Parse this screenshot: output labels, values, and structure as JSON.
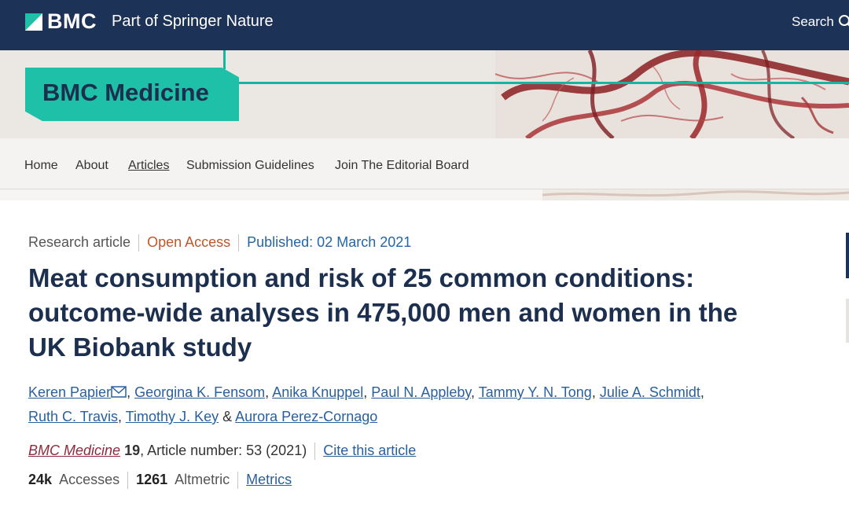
{
  "header": {
    "logo_text": "BMC",
    "logo_subtitle": "Part of Springer Nature",
    "search_label": "Search",
    "brand_color": "#1d3257"
  },
  "journal": {
    "name": "BMC Medicine",
    "accent_color": "#1fc0a8"
  },
  "nav": {
    "items": [
      "Home",
      "About",
      "Articles",
      "Submission Guidelines",
      "Join The Editorial Board"
    ],
    "active": "Articles"
  },
  "article": {
    "type": "Research article",
    "access": "Open Access",
    "published": "Published: 02 March 2021",
    "title": "Meat consumption and risk of 25 common conditions: outcome-wide analyses in 475,000 men and women in the UK Biobank study",
    "authors": [
      "Keren Papier",
      "Georgina K. Fensom",
      "Anika Knuppel",
      "Paul N. Appleby",
      "Tammy Y. N. Tong",
      "Julie A. Schmidt",
      "Ruth C. Travis",
      "Timothy J. Key",
      "Aurora Perez-Cornago"
    ],
    "author_joiner": "&",
    "citation": {
      "journal": "BMC Medicine",
      "volume": "19",
      "article_number": ", Article number: 53 (2021)",
      "cite_link": "Cite this article"
    },
    "metrics": {
      "accesses_value": "24k",
      "accesses_label": "Accesses",
      "altmetric_value": "1261",
      "altmetric_label": "Altmetric",
      "metrics_link": "Metrics"
    }
  }
}
